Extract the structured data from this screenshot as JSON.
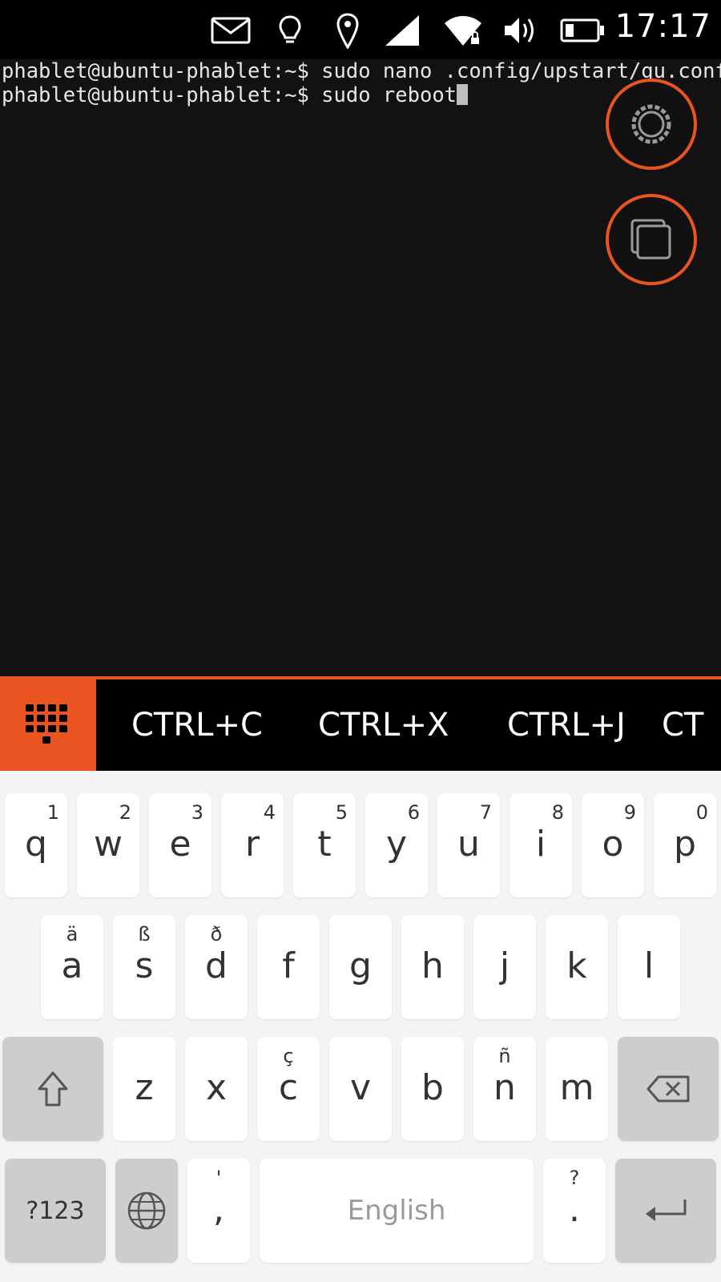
{
  "statusbar": {
    "icons": [
      "message-icon",
      "lightbulb-icon",
      "location-icon",
      "cellular-signal-icon",
      "wifi-secure-icon",
      "volume-icon",
      "battery-icon"
    ],
    "time": "17:17"
  },
  "terminal": {
    "lines": [
      "phablet@ubuntu-phablet:~$ sudo nano .config/upstart/gu.conf",
      "phablet@ubuntu-phablet:~$ sudo reboot"
    ]
  },
  "fabs": {
    "settings_icon": "gear-icon",
    "tabs_icon": "windows-icon"
  },
  "keybar": {
    "menu_icon": "keypad-icon",
    "shortcuts": [
      "CTRL+C",
      "CTRL+X",
      "CTRL+J",
      "CT"
    ]
  },
  "keyboard": {
    "row1": [
      {
        "ch": "q",
        "sup": "1"
      },
      {
        "ch": "w",
        "sup": "2"
      },
      {
        "ch": "e",
        "sup": "3"
      },
      {
        "ch": "r",
        "sup": "4"
      },
      {
        "ch": "t",
        "sup": "5"
      },
      {
        "ch": "y",
        "sup": "6"
      },
      {
        "ch": "u",
        "sup": "7"
      },
      {
        "ch": "i",
        "sup": "8"
      },
      {
        "ch": "o",
        "sup": "9"
      },
      {
        "ch": "p",
        "sup": "0"
      }
    ],
    "row2": [
      {
        "ch": "a",
        "sup": "ä"
      },
      {
        "ch": "s",
        "sup": "ß"
      },
      {
        "ch": "d",
        "sup": "ð"
      },
      {
        "ch": "f",
        "sup": ""
      },
      {
        "ch": "g",
        "sup": ""
      },
      {
        "ch": "h",
        "sup": ""
      },
      {
        "ch": "j",
        "sup": ""
      },
      {
        "ch": "k",
        "sup": ""
      },
      {
        "ch": "l",
        "sup": ""
      }
    ],
    "row3": [
      {
        "ch": "z",
        "sup": ""
      },
      {
        "ch": "x",
        "sup": ""
      },
      {
        "ch": "c",
        "sup": "ç"
      },
      {
        "ch": "v",
        "sup": ""
      },
      {
        "ch": "b",
        "sup": ""
      },
      {
        "ch": "n",
        "sup": "ñ"
      },
      {
        "ch": "m",
        "sup": ""
      }
    ],
    "symbols_label": "?123",
    "comma": {
      "ch": ",",
      "sup": "'"
    },
    "space_label": "English",
    "period": {
      "ch": ".",
      "sup": "?"
    },
    "accent_color": "#E95420"
  }
}
